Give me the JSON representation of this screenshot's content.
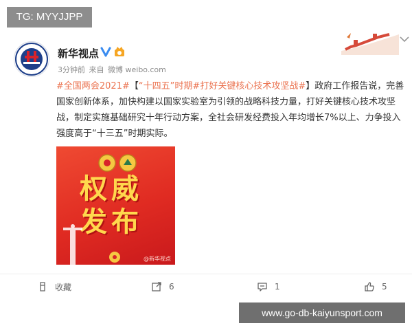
{
  "overlay": {
    "tg_label": "TG: MYYJJPP",
    "site_label": "www.go-db-kaiyunsport.com"
  },
  "author": {
    "name": "新华视点",
    "avatar_text": "XINHUA"
  },
  "meta": {
    "time": "3分钟前",
    "source_prefix": "来自",
    "source_name": "微博 weibo.com"
  },
  "post": {
    "hashtag1": "#全国两会2021#",
    "bracket_open": "【",
    "quote_open": "“",
    "quote_term": "十四五",
    "quote_close": "”",
    "period": "时期",
    "hashtag2": "#打好关键核心技术攻坚战#",
    "bracket_close": "】",
    "body": "政府工作报告说，完善国家创新体系，加快构建以国家实验室为引领的战略科技力量，打好关键核心技术攻坚战，制定实施基础研究十年行动方案，全社会研发经费投入年均增长7%以上、力争投入强度高于“十三五”时期实际。"
  },
  "image": {
    "line1": "权威",
    "line2": "发布",
    "watermark": "@新华视点"
  },
  "actions": {
    "collect_label": "收藏",
    "repost_count": "6",
    "comment_count": "1",
    "like_count": "5"
  },
  "colors": {
    "link": "#eb7350",
    "text": "#333333",
    "muted": "#8c8c8c",
    "verified": "#3a8cf0",
    "image_red": "#e02b22"
  }
}
